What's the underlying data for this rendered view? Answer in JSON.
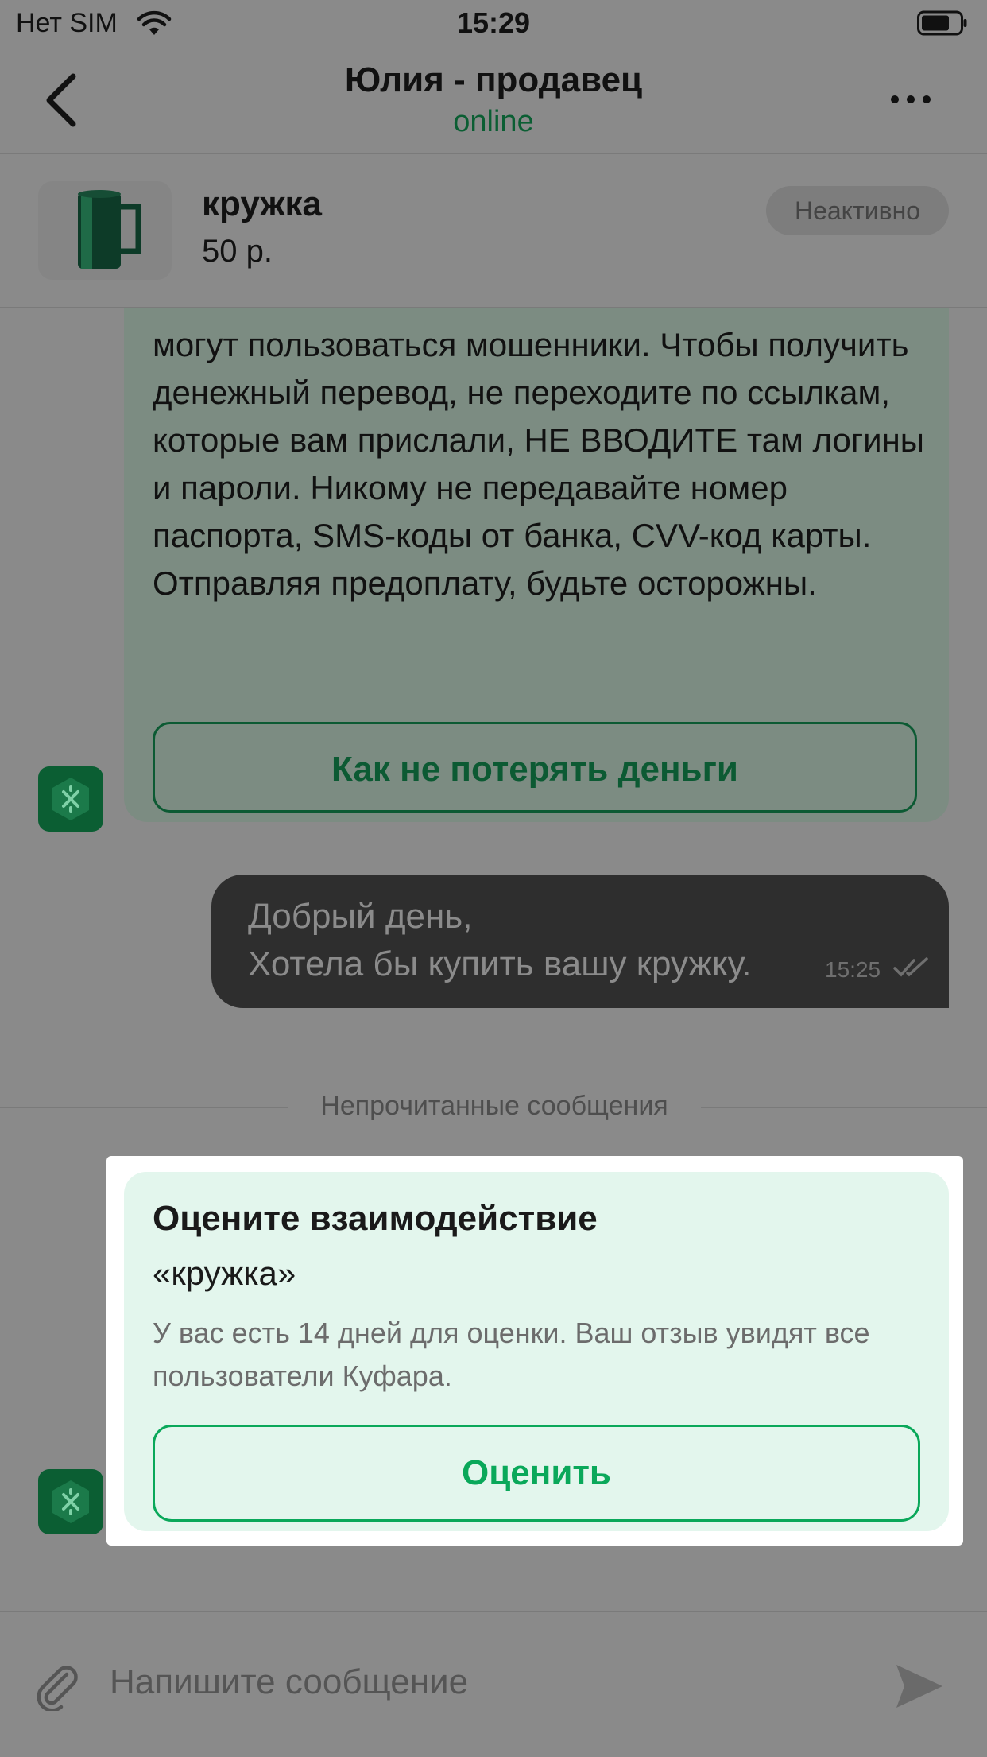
{
  "status_bar": {
    "carrier": "Нет SIM",
    "time": "15:29",
    "icons": [
      "wifi-icon",
      "battery-icon"
    ]
  },
  "header": {
    "back_icon": "chevron-left-icon",
    "title": "Юлия - продавец",
    "presence": "online",
    "more_icon": "more-dots-icon"
  },
  "product": {
    "name": "кружка",
    "price": "50 р.",
    "status": "Неактивно"
  },
  "messages": {
    "warning": {
      "text": "могут пользоваться мошенники. Чтобы получить денежный перевод, не переходите по ссылкам, которые вам прислали, НЕ ВВОДИТЕ там логины и пароли. Никому не передавайте номер паспорта, SMS-коды от банка, CVV-код карты. Отправляя предоплату, будьте осторожны.",
      "link_label": "Как не потерять деньги"
    },
    "outgoing": {
      "line1": "Добрый день,",
      "line2": "Хотела бы купить вашу кружку.",
      "time": "15:25"
    },
    "unread_divider": "Непрочитанные сообщения",
    "rating_card": {
      "title": "Оцените взаимодействие",
      "item": "«кружка»",
      "description": "У вас есть 14 дней для оценки. Ваш отзыв увидят все пользователи Куфара.",
      "button_label": "Оценить"
    }
  },
  "composer": {
    "placeholder": "Напишите сообщение",
    "attach_icon": "paperclip-icon",
    "send_icon": "send-icon"
  },
  "colors": {
    "accent_green": "#0aa85a",
    "dark_green": "#0b5e33",
    "overlay_gray": "#8a8a8a",
    "card_bg": "#e3f6ed"
  }
}
